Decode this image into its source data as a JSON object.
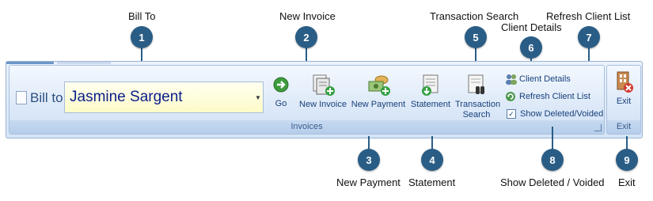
{
  "callouts": [
    {
      "num": "1",
      "label": "Bill To"
    },
    {
      "num": "2",
      "label": "New Invoice"
    },
    {
      "num": "3",
      "label": "New Payment"
    },
    {
      "num": "4",
      "label": "Statement"
    },
    {
      "num": "5",
      "label": "Transaction Search"
    },
    {
      "num": "6",
      "label": "Client Details"
    },
    {
      "num": "7",
      "label": "Refresh Client List"
    },
    {
      "num": "8",
      "label": "Show Deleted / Voided"
    },
    {
      "num": "9",
      "label": "Exit"
    }
  ],
  "ribbon": {
    "bill_to_label": "Bill to",
    "bill_to_value": "Jasmine Sargent",
    "buttons": {
      "go": "Go",
      "new_invoice": "New Invoice",
      "new_payment": "New Payment",
      "statement": "Statement",
      "transaction_search_line1": "Transaction",
      "transaction_search_line2": "Search",
      "exit": "Exit"
    },
    "small": {
      "client_details": "Client Details",
      "refresh_client_list": "Refresh Client List",
      "show_deleted_voided": "Show Deleted/Voided",
      "show_deleted_checked": true
    },
    "groups": {
      "invoices": "Invoices",
      "exit": "Exit"
    }
  },
  "colors": {
    "badge": "#2a5d86",
    "ribbon_text": "#18407a",
    "combo_text": "#0a1e8c"
  }
}
